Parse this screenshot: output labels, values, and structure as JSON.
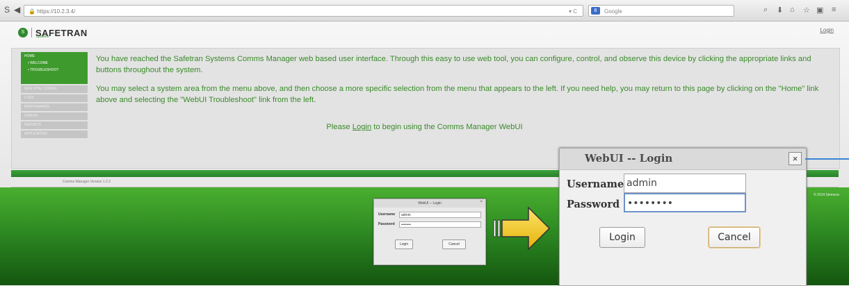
{
  "browser": {
    "url": "https://10.2.3.4/",
    "search_placeholder": "Google",
    "search_engine_icon": "google-icon",
    "icons": [
      "back-icon",
      "lock-icon",
      "reload-icon",
      "search-icon",
      "download-icon",
      "home-icon",
      "star-icon",
      "bookmark-icon",
      "menu-icon"
    ]
  },
  "page": {
    "logo_text": "SAFETRAN",
    "logo_sub": "systems",
    "login_link": "Login",
    "sidebar": {
      "home": "HOME",
      "sub_items": [
        "WELCOME",
        "TROUBLESHOOT"
      ],
      "items": [
        "NON VITAL CONFIG",
        "LOGS",
        "MAINTENANCE",
        "STATUS",
        "REPORTS",
        "APPLICATION"
      ]
    },
    "paragraph1": "You have reached the Safetran Systems Comms Manager web based user interface. Through this easy to use web tool, you can configure, control, and observe this device by clicking the appropriate links and buttons throughout the system.",
    "paragraph2": "You may select a system area from the menu above, and then choose a more specific selection from the menu that appears to the left. If you need help, you may return to this page by clicking on the \"Home\" link above and selecting the \"WebUI Troubleshoot\" link from the left.",
    "please_prefix": "Please ",
    "please_link": "Login",
    "please_suffix": " to begin using the Comms Manager WebUI",
    "version": "Comms Manager Version 1.2.3",
    "copyright": "© 2014 Siemens"
  },
  "small_dialog": {
    "title": "WebUI -- Login",
    "username_label": "Username",
    "username_value": "admin",
    "password_label": "Password",
    "password_value": "••••••••",
    "login_button": "Login",
    "cancel_button": "Cancel",
    "close_glyph": "×"
  },
  "big_dialog": {
    "title": "WebUI -- Login",
    "username_label": "Username",
    "username_value": "admin",
    "password_label": "Password",
    "password_value": "••••••••",
    "login_button": "Login",
    "cancel_button": "Cancel",
    "close_glyph": "×"
  },
  "colors": {
    "green_brand": "#3e9a2d",
    "text_green": "#3a8a2a",
    "arrow_yellow": "#f2c417"
  }
}
